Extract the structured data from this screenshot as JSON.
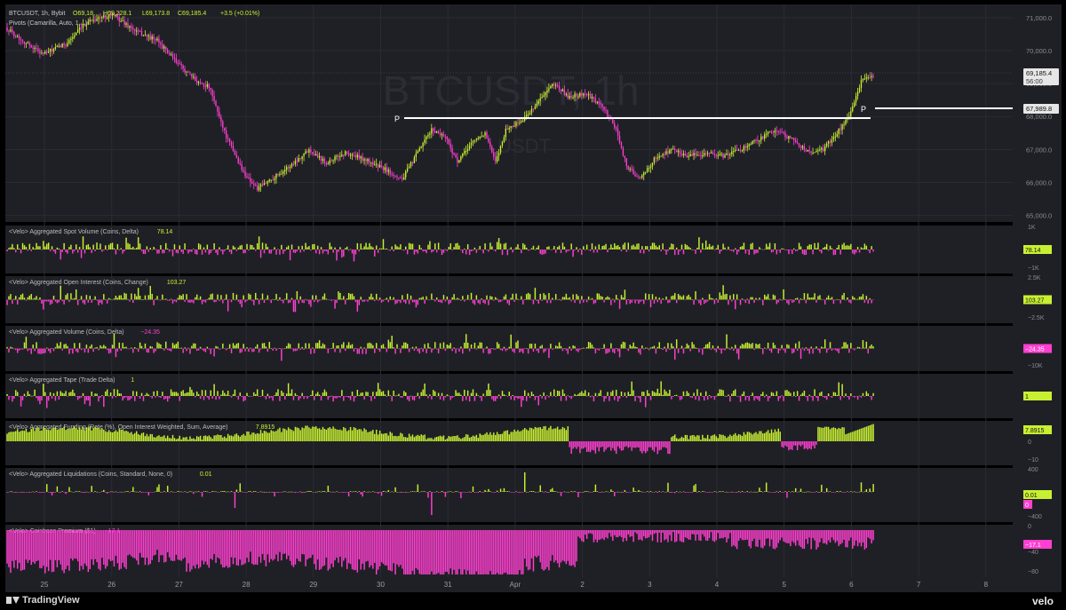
{
  "colors": {
    "up": "#c8f032",
    "down": "#ff3fd0",
    "bg": "#1f2026",
    "grid": "#2a2b32",
    "axis_text": "#8a8b91",
    "pivot": "#ffffff"
  },
  "header": {
    "symbol": "BTCUSDT, 1h, Bybit",
    "open": "O69,18…",
    "high": "H69,228.1",
    "low": "L69,173.8",
    "close": "C69,185.4",
    "change": "+3.5 (+0.01%)",
    "indicator": "Pivots (Camarilla, Auto, 1…)"
  },
  "watermark": {
    "ticker": "BTCUSDT, 1h",
    "sub": "USDT"
  },
  "price_axis": {
    "ticks": [
      "71,000.0",
      "70,000.0",
      "69,000.0",
      "68,000.0",
      "67,000.0",
      "66,000.0",
      "65,000.0"
    ],
    "last_price": "69,185.4",
    "countdown": "56:00",
    "pivot_price": "67,989.8",
    "pivot_label": "P"
  },
  "time_axis": {
    "labels": [
      "25",
      "26",
      "27",
      "28",
      "29",
      "30",
      "31",
      "Apr",
      "2",
      "3",
      "4",
      "5",
      "6",
      "7",
      "8"
    ]
  },
  "panes": [
    {
      "title": "<Velo> Aggregated Spot Volume (Coins, Delta)",
      "value": "78.14",
      "value_type": "up",
      "axis_top": "1K",
      "axis_bottom": "−1K",
      "axis_mid": ""
    },
    {
      "title": "<Velo> Aggregated Open Interest (Coins, Change)",
      "value": "103.27",
      "value_type": "up",
      "axis_top": "2.5K",
      "axis_bottom": "−2.5K",
      "axis_mid": ""
    },
    {
      "title": "<Velo> Aggregated Volume (Coins, Delta)",
      "value": "−24.35",
      "value_type": "down",
      "axis_top": "",
      "axis_bottom": "−10K",
      "axis_mid": ""
    },
    {
      "title": "<Velo> Aggregated Tape (Trade Delta)",
      "value": "1",
      "value_type": "up",
      "axis_top": "",
      "axis_bottom": "",
      "axis_mid": ""
    },
    {
      "title": "<Velo> Aggregated Funding (Rate (%), Open Interest Weighted, Sum, Average)",
      "value": "7.8915",
      "value_type": "up",
      "axis_top": "",
      "axis_bottom": "−10",
      "axis_mid": "0"
    },
    {
      "title": "<Velo> Aggregated Liquidations (Coins, Standard, None, 0)",
      "value": "0.01",
      "value_type": "up",
      "value2": "0",
      "axis_top": "400",
      "axis_bottom": "−400",
      "axis_mid": ""
    },
    {
      "title": "<Velo> Coinbase Premium ($1)",
      "value": "−17.1",
      "value_type": "down",
      "axis_top": "0",
      "axis_bottom": "−80",
      "axis_mid": "−40"
    }
  ],
  "footer": {
    "tv_label": "TradingView",
    "velo_label": "velo"
  },
  "chart_data": {
    "type": "candlestick",
    "symbol": "BTCUSDT",
    "interval": "1h",
    "x_labels": [
      "25",
      "26",
      "27",
      "28",
      "29",
      "30",
      "31",
      "Apr",
      "2",
      "3",
      "4",
      "5",
      "6",
      "7",
      "8"
    ],
    "ylim": [
      64800,
      71400
    ],
    "pivot_P": 67989.8,
    "last_close": 69185.4,
    "price_path": [
      [
        0,
        70700
      ],
      [
        10,
        70300
      ],
      [
        22,
        69900
      ],
      [
        35,
        70200
      ],
      [
        48,
        70900
      ],
      [
        62,
        71100
      ],
      [
        75,
        70600
      ],
      [
        88,
        70300
      ],
      [
        100,
        69600
      ],
      [
        110,
        69100
      ],
      [
        118,
        68900
      ],
      [
        128,
        67400
      ],
      [
        138,
        66300
      ],
      [
        146,
        65800
      ],
      [
        154,
        66100
      ],
      [
        165,
        66500
      ],
      [
        176,
        67000
      ],
      [
        186,
        66600
      ],
      [
        197,
        66900
      ],
      [
        208,
        66700
      ],
      [
        220,
        66400
      ],
      [
        230,
        66100
      ],
      [
        240,
        67000
      ],
      [
        247,
        67600
      ],
      [
        255,
        67400
      ],
      [
        262,
        66600
      ],
      [
        270,
        67200
      ],
      [
        278,
        67500
      ],
      [
        284,
        66600
      ],
      [
        290,
        67600
      ],
      [
        300,
        67900
      ],
      [
        308,
        68400
      ],
      [
        318,
        69000
      ],
      [
        326,
        68600
      ],
      [
        336,
        68700
      ],
      [
        346,
        68300
      ],
      [
        354,
        67600
      ],
      [
        360,
        66500
      ],
      [
        368,
        66100
      ],
      [
        376,
        66700
      ],
      [
        386,
        67000
      ],
      [
        396,
        66800
      ],
      [
        406,
        66900
      ],
      [
        416,
        66800
      ],
      [
        426,
        67000
      ],
      [
        436,
        67300
      ],
      [
        446,
        67600
      ],
      [
        456,
        67300
      ],
      [
        466,
        66900
      ],
      [
        474,
        67000
      ],
      [
        482,
        67500
      ],
      [
        490,
        68100
      ],
      [
        496,
        69100
      ],
      [
        502,
        69200
      ]
    ],
    "subpanes": [
      "Aggregated Spot Volume",
      "Aggregated Open Interest",
      "Aggregated Volume",
      "Aggregated Tape",
      "Aggregated Funding",
      "Aggregated Liquidations",
      "Coinbase Premium"
    ]
  }
}
